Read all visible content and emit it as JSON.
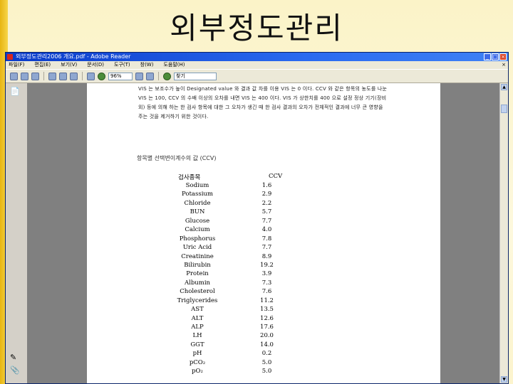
{
  "slide": {
    "title": "외부정도관리"
  },
  "window": {
    "title": "외부정도관리2006 개요.pdf - Adobe Reader",
    "buttons": [
      "_",
      "□",
      "×"
    ]
  },
  "menu": {
    "items": [
      "파일(F)",
      "편집(E)",
      "보기(V)",
      "문서(D)",
      "도구(T)",
      "창(W)",
      "도움말(H)"
    ],
    "close": "×"
  },
  "toolbar": {
    "zoom_value": "96%",
    "find_placeholder": "찾기"
  },
  "side_panel": {
    "icons": [
      "pages-icon",
      "attachment-icon",
      "paperclip-icon"
    ]
  },
  "document": {
    "paragraph": "VIS 는 보조수가 높이 Designated value 와 결과 값 차를 이용 VIS 는 0 이다. CCV 와 같은 항목의 농도를 나눈 VIS 는 100, CCV 의 수배 이상의 오차를 내면 VIS 는 400 이다. VIS 가 상한치를 400 으로 설정 정상 기기(장비 외) 등에 의해 하는 한 검사 항목에 대한 그 오차가 생긴 때 한 검사 결과의 오차가 전체적인 결과에 너무 큰 영향을 주는 것을 제거하기 위한 것이다.",
    "table_caption": "항목별 선택변이계수의 값 (CCV)",
    "col_test": "검사종목",
    "col_ccv": "CCV",
    "rows": [
      {
        "test": "Sodium",
        "ccv": "1.6"
      },
      {
        "test": "Potassium",
        "ccv": "2.9"
      },
      {
        "test": "Chloride",
        "ccv": "2.2"
      },
      {
        "test": "BUN",
        "ccv": "5.7"
      },
      {
        "test": "Glucose",
        "ccv": "7.7"
      },
      {
        "test": "Calcium",
        "ccv": "4.0"
      },
      {
        "test": "Phosphorus",
        "ccv": "7.8"
      },
      {
        "test": "Uric Acid",
        "ccv": "7.7"
      },
      {
        "test": "Creatinine",
        "ccv": "8.9"
      },
      {
        "test": "Bilirubin",
        "ccv": "19.2"
      },
      {
        "test": "Protein",
        "ccv": "3.9"
      },
      {
        "test": "Albumin",
        "ccv": "7.3"
      },
      {
        "test": "Cholesterol",
        "ccv": "7.6"
      },
      {
        "test": "Triglycerides",
        "ccv": "11.2"
      },
      {
        "test": "AST",
        "ccv": "13.5"
      },
      {
        "test": "ALT",
        "ccv": "12.6"
      },
      {
        "test": "ALP",
        "ccv": "17.6"
      },
      {
        "test": "LH",
        "ccv": "20.0"
      },
      {
        "test": "GGT",
        "ccv": "14.0"
      },
      {
        "test": "pH",
        "ccv": "0.2"
      },
      {
        "test": "pCO₂",
        "ccv": "5.0"
      },
      {
        "test": "pO₂",
        "ccv": "5.0"
      }
    ]
  },
  "colors": {
    "slide_bg": "#fdf6cf",
    "accent_bar": "#e7b512",
    "titlebar": "#0a3bc9"
  }
}
